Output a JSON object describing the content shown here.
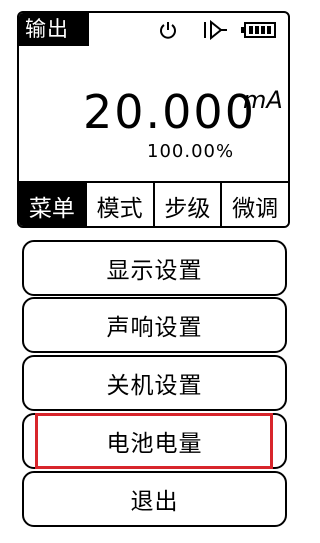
{
  "header": {
    "mode_label": "输出",
    "icons": [
      "power-icon",
      "diode-icon",
      "battery-icon"
    ]
  },
  "reading": {
    "value": "20.000",
    "unit": "mA",
    "percent": "100.00%"
  },
  "tabs": [
    {
      "label": "菜单",
      "active": true
    },
    {
      "label": "模式",
      "active": false
    },
    {
      "label": "步级",
      "active": false
    },
    {
      "label": "微调",
      "active": false
    }
  ],
  "menu": {
    "items": [
      {
        "label": "显示设置"
      },
      {
        "label": "声响设置"
      },
      {
        "label": "关机设置"
      },
      {
        "label": "电池电量",
        "highlighted": true
      },
      {
        "label": "退出"
      }
    ]
  },
  "colors": {
    "highlight": "#d8252b",
    "foreground": "#000000",
    "background": "#ffffff"
  }
}
